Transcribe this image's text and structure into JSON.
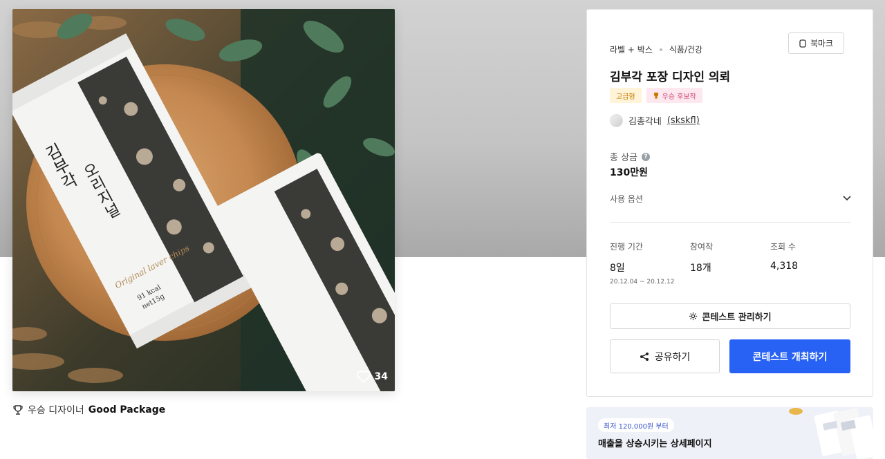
{
  "hero": {
    "likes": "34",
    "winner_prefix": "우승 디자이너",
    "winner_name": "Good Package"
  },
  "product_art": {
    "brand_line1": "김부각",
    "brand_line2": "오리지널",
    "tagline": "Original laver chips",
    "calories": "91 kcal",
    "net": "net15g"
  },
  "contest": {
    "category1": "라벨 + 박스",
    "category2": "식품/건강",
    "bookmark_label": "북마크",
    "title": "김부각 포장 디자인 의뢰",
    "tag_premium": "고급형",
    "tag_candidate": "우승 후보작",
    "author_name": "김총각네",
    "author_handle": "(skskfl)",
    "prize_label": "총 상금",
    "prize_value": "130만원",
    "options_label": "사용 옵션",
    "stats": {
      "period_label": "진행 기간",
      "period_value": "8일",
      "period_range": "20.12.04 ~ 20.12.12",
      "entries_label": "참여작",
      "entries_value": "18개",
      "views_label": "조회 수",
      "views_value": "4,318"
    },
    "manage_button": "콘테스트 관리하기",
    "share_button": "공유하기",
    "host_button": "콘테스트 개최하기"
  },
  "ad": {
    "pill": "최저 120,000원 부터",
    "text": "매출을 상승시키는 상세페이지"
  },
  "colors": {
    "primary": "#2762f4",
    "premium_tag_bg": "#fff4d8",
    "candidate_tag_bg": "#fde8ef"
  }
}
